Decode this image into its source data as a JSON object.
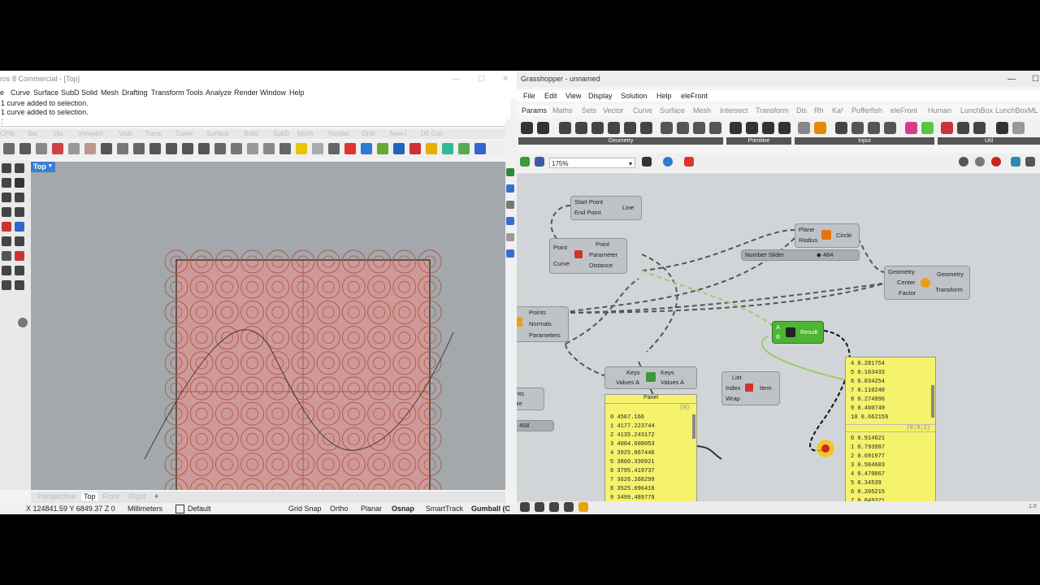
{
  "rhino": {
    "title": "ros 8 Commercial - [Top]",
    "menu": [
      "e",
      "Curve",
      "Surface",
      "SubD",
      "Solid",
      "Mesh",
      "Drafting",
      "Transform",
      "Tools",
      "Analyze",
      "Render",
      "Window",
      "Help"
    ],
    "command_history": [
      "1 curve added to selection.",
      "1 curve added to selection.",
      ":"
    ],
    "toolbar_tabs": [
      "CPla",
      "Set",
      "Dis",
      "Viewport",
      "Visib",
      "Trans",
      "Curve",
      "Surface",
      "Solid",
      "SubD",
      "Mesh",
      "Render",
      "Draf",
      "New i",
      "D5 Con"
    ],
    "viewport_label": "Top",
    "viewport_tabs": [
      "Perspective",
      "Top",
      "Front",
      "Right",
      "+"
    ],
    "status": {
      "coords": "X 124841.59 Y 6849.37 Z 0",
      "units": "Millimeters",
      "layer": "Default",
      "toggles": [
        "Grid Snap",
        "Ortho",
        "Planar",
        "Osnap",
        "SmartTrack",
        "Gumball (C"
      ]
    }
  },
  "gh": {
    "title": "Grasshopper - unnamed",
    "menu": [
      "File",
      "Edit",
      "View",
      "Display",
      "Solution",
      "Help",
      "eleFront"
    ],
    "tabs": [
      "Params",
      "Maths",
      "Sets",
      "Vector",
      "Curve",
      "Surface",
      "Mesh",
      "Intersect",
      "Transform",
      "Dis",
      "Rh",
      "Ka²",
      "Pufferfish",
      "eleFront",
      "Human",
      "LunchBox",
      "LunchBoxML"
    ],
    "ribbon_groups": [
      "Geometry",
      "Primitive",
      "Input",
      "Util"
    ],
    "zoom": "175%",
    "components": {
      "line": {
        "inputs": [
          "Start Point",
          "End Point"
        ],
        "output": "Line"
      },
      "circle": {
        "inputs": [
          "Plane",
          "Radius"
        ],
        "output": "Circle"
      },
      "slider": {
        "label": "Number Slider",
        "value": "◆ 484"
      },
      "evaluate": {
        "inputs": [
          "Point",
          "Curve"
        ],
        "outputs": [
          "Point",
          "Parameter",
          "Distance"
        ]
      },
      "scale": {
        "inputs": [
          "Geometry",
          "Center",
          "Factor"
        ],
        "outputs": [
          "Geometry",
          "Transform"
        ]
      },
      "divide": {
        "outputs": [
          "Points",
          "Normals",
          "Parameters"
        ]
      },
      "expression": {
        "inputs": [
          "A",
          "B"
        ],
        "output": "Result"
      },
      "sort": {
        "inputs": [
          "Keys",
          "Values A"
        ],
        "outputs": [
          "Keys",
          "Values A"
        ]
      },
      "list_item": {
        "inputs": [
          "List",
          "Index",
          "Wrap"
        ],
        "output": "Item"
      },
      "small_a": {
        "label": "nts",
        "sub": "ze"
      },
      "small_b": {
        "value": "458"
      }
    },
    "panel_left": {
      "title": "Panel",
      "path": "{0}",
      "rows": [
        "0 4567.166",
        "1 4177.223744",
        "2 4135.243172",
        "3 4004.608053",
        "4 3925.067446",
        "5 3860.330921",
        "6 3795.419737",
        "7 3626.268299",
        "8 3525.096418",
        "9 3499.489779"
      ]
    },
    "panel_right": {
      "rows_top": [
        "4 0.281754",
        "5 0.163433",
        "6 0.034254",
        "7 0.110248",
        "8 0.274996",
        "9 0.460749",
        "10 0.662159"
      ],
      "path": "{0;0;2}",
      "rows_bottom": [
        "0 0.914621",
        "1 0.793987",
        "2 0.691977",
        "3 0.584603",
        "4 0.470067",
        "5 0.34539",
        "6 0.205215",
        "7 0.049371"
      ]
    },
    "corner_text": "1.0"
  },
  "colors": {
    "rect_fill": "#cf9999",
    "circle_stroke": "#b0573f",
    "panel": "#f5f26b",
    "green_comp": "#4cb534"
  }
}
